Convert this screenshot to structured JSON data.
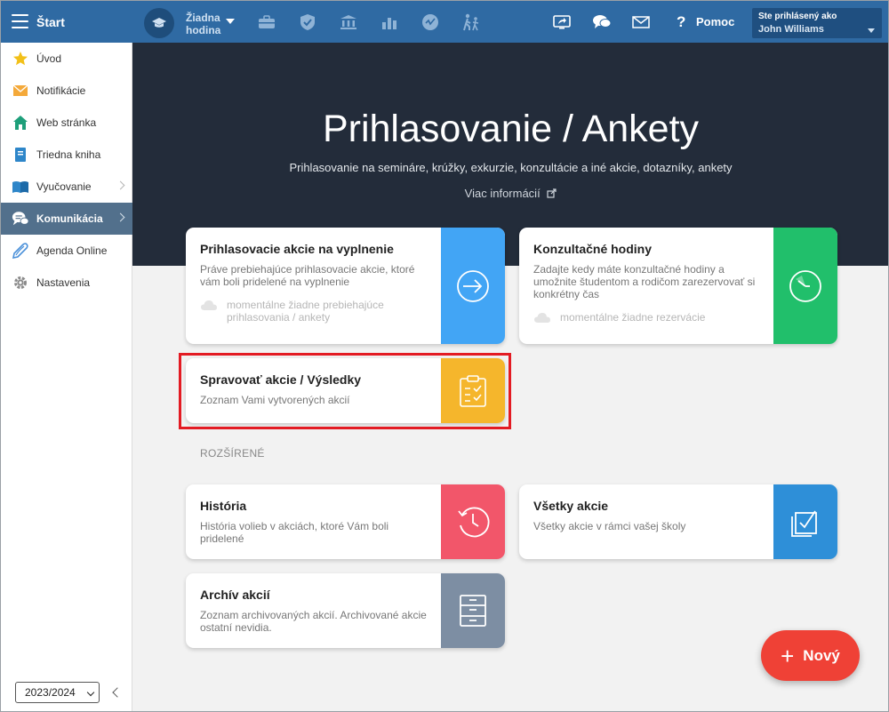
{
  "topbar": {
    "start_label": "Štart",
    "role_label": "Žiadna hodina",
    "help_label": "Pomoc",
    "user_caption": "Ste prihlásený ako",
    "user_name": "John Williams",
    "icons": [
      "briefcase-icon",
      "shield-icon",
      "bank-icon",
      "bar-chart-icon",
      "speedometer-icon",
      "walking-icon",
      "screen-share-icon",
      "chat-icon",
      "mail-icon",
      "help-icon"
    ]
  },
  "sidebar": {
    "items": [
      {
        "label": "Úvod",
        "icon": "star-icon"
      },
      {
        "label": "Notifikácie",
        "icon": "envelope-icon"
      },
      {
        "label": "Web stránka",
        "icon": "house-icon"
      },
      {
        "label": "Triedna kniha",
        "icon": "book-icon"
      },
      {
        "label": "Vyučovanie",
        "icon": "open-book-icon"
      },
      {
        "label": "Komunikácia",
        "icon": "chat-bubbles-icon"
      },
      {
        "label": "Agenda Online",
        "icon": "pen-icon"
      },
      {
        "label": "Nastavenia",
        "icon": "gear-icon"
      }
    ],
    "active_item": "Komunikácia",
    "school_year": "2023/2024"
  },
  "hero": {
    "title": "Prihlasovanie / Ankety",
    "subtitle": "Prihlasovanie na semináre, krúžky, exkurzie, konzultácie a iné akcie, dotazníky, ankety",
    "link": "Viac informácií"
  },
  "cards": {
    "pending": {
      "title": "Prihlasovacie akcie na vyplnenie",
      "desc": "Práve prebiehajúce prihlasovacie akcie, ktoré vám boli pridelené na vyplnenie",
      "note": "momentálne žiadne prebiehajúce prihlasovania / ankety",
      "color": "#42a5f5"
    },
    "consult": {
      "title": "Konzultačné hodiny",
      "desc": "Zadajte kedy máte konzultačné hodiny a umožnite študentom a rodičom zarezervovať si konkrétny čas",
      "note": "momentálne žiadne rezervácie",
      "color": "#21bf6b"
    },
    "manage": {
      "title": "Spravovať akcie / Výsledky",
      "desc": "Zoznam Vami vytvorených akcií",
      "color": "#f5b62c"
    },
    "section_label": "ROZŠÍRENÉ",
    "history": {
      "title": "História",
      "desc": "História volieb v akciách, ktoré Vám boli pridelené",
      "color": "#f2566a"
    },
    "all": {
      "title": "Všetky akcie",
      "desc": "Všetky akcie v rámci vašej školy",
      "color": "#2e8fd8"
    },
    "archive": {
      "title": "Archív akcií",
      "desc": "Zoznam archivovaných akcií. Archivované akcie ostatní nevidia.",
      "color": "#7d8ea3"
    }
  },
  "fab": {
    "label": "Nový"
  },
  "colors": {
    "topbar": "#2f6aa3",
    "hero": "#232c3a",
    "sidebar_active": "#52708c",
    "fab": "#ef4136",
    "highlight": "#e31b23"
  }
}
